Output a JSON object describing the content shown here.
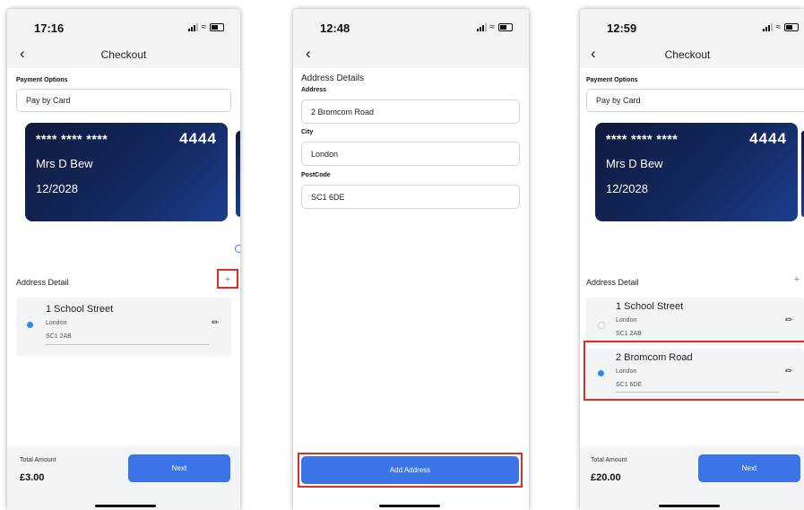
{
  "screens": [
    {
      "time": "17:16",
      "title": "Checkout",
      "payment_options_label": "Payment Options",
      "payment_method": "Pay by Card",
      "card": {
        "masked_groups": "****  ****  ****",
        "last4": "4444",
        "holder": "Mrs D Bew",
        "expiry": "12/2028"
      },
      "address_detail_label": "Address Detail",
      "add_icon": "+",
      "addresses": [
        {
          "line1": "1 School Street",
          "city": "London",
          "postcode": "SC1 2AB",
          "selected": true
        }
      ],
      "total_label": "Total Amount",
      "total_value": "£3.00",
      "next_label": "Next"
    },
    {
      "time": "12:48",
      "heading": "Address Details",
      "address_label": "Address",
      "address_value": "2 Bromcom Road",
      "city_label": "City",
      "city_value": "London",
      "postcode_label": "PostCode",
      "postcode_value": "SC1 6DE",
      "add_address_label": "Add Address"
    },
    {
      "time": "12:59",
      "title": "Checkout",
      "payment_options_label": "Payment Options",
      "payment_method": "Pay by Card",
      "card": {
        "masked_groups": "****  ****  ****",
        "last4": "4444",
        "holder": "Mrs D Bew",
        "expiry": "12/2028"
      },
      "address_detail_label": "Address Detail",
      "add_icon": "+",
      "addresses": [
        {
          "line1": "1 School Street",
          "city": "London",
          "postcode": "SC1 2AB",
          "selected": false
        },
        {
          "line1": "2 Bromcom Road",
          "city": "London",
          "postcode": "SC1 6DE",
          "selected": true
        }
      ],
      "total_label": "Total Amount",
      "total_value": "£20.00",
      "next_label": "Next"
    }
  ],
  "icons": {
    "back": "chevron-left-icon",
    "edit": "pencil-icon",
    "add": "plus-icon"
  },
  "colors": {
    "accent": "#3b74e6",
    "highlight": "#e02d22",
    "card_dark": "#0f1a3e",
    "card_light": "#1b3f8f"
  }
}
